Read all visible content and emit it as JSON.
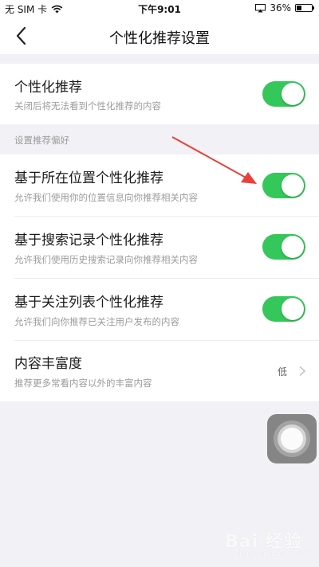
{
  "status_bar": {
    "carrier": "无 SIM 卡",
    "time": "下午9:01",
    "battery": "36%",
    "battery_level": 0.36
  },
  "nav": {
    "title": "个性化推荐设置"
  },
  "main_toggle": {
    "title": "个性化推荐",
    "subtitle": "关闭后将无法看到个性化推荐的内容",
    "on": true
  },
  "section": {
    "label": "设置推荐偏好"
  },
  "preferences": [
    {
      "title": "基于所在位置个性化推荐",
      "subtitle": "允许我们使用你的位置信息向你推荐相关内容",
      "on": true
    },
    {
      "title": "基于搜索记录个性化推荐",
      "subtitle": "允许我们使用历史搜索记录向你推荐相关内容",
      "on": true
    },
    {
      "title": "基于关注列表个性化推荐",
      "subtitle": "允许我们向你推荐已关注用户发布的内容",
      "on": true
    }
  ],
  "richness": {
    "title": "内容丰富度",
    "subtitle": "推荐更多常看内容以外的丰富内容",
    "value": "低"
  },
  "watermark": {
    "text": "Bai 经验",
    "sub": "jingyan.baidu.com"
  },
  "colors": {
    "toggle_on": "#34c759",
    "arrow": "#e8403a",
    "background": "#f2f2f6"
  }
}
